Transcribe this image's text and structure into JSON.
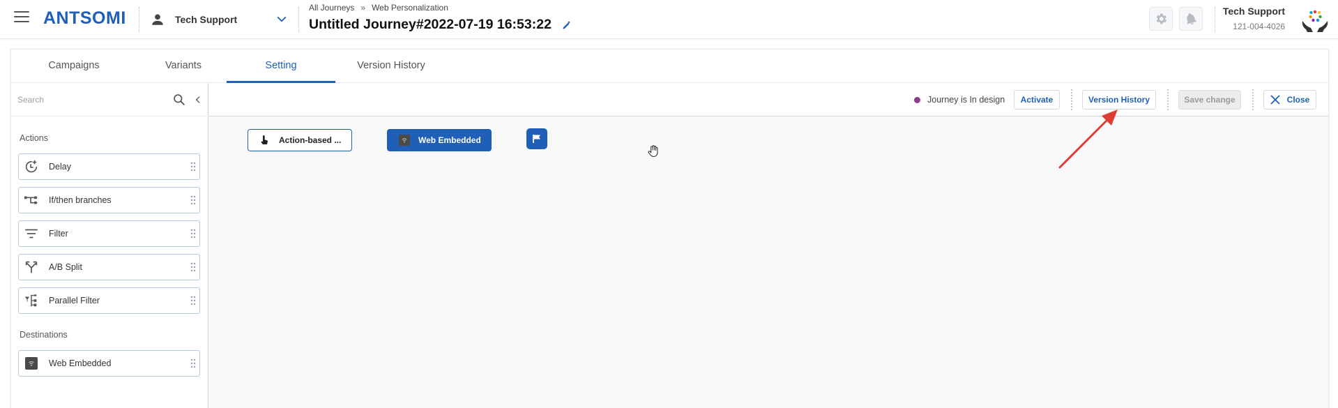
{
  "header": {
    "logo_text": "ANTSOMI",
    "portal_name": "Tech Support",
    "breadcrumb": [
      "All Journeys",
      "»",
      "Web Personalization"
    ],
    "journey_title": "Untitled Journey#2022-07-19 16:53:22",
    "user_name": "Tech Support",
    "user_id": "121-004-4026"
  },
  "tabs": [
    {
      "label": "Campaigns",
      "active": false
    },
    {
      "label": "Variants",
      "active": false
    },
    {
      "label": "Setting",
      "active": true
    },
    {
      "label": "Version History",
      "active": false
    }
  ],
  "sidebar": {
    "search_placeholder": "Search",
    "actions_label": "Actions",
    "actions": [
      {
        "label": "Delay",
        "icon": "delay-clock-icon"
      },
      {
        "label": "If/then branches",
        "icon": "branches-icon"
      },
      {
        "label": "Filter",
        "icon": "filter-icon"
      },
      {
        "label": "A/B Split",
        "icon": "ab-split-icon"
      },
      {
        "label": "Parallel Filter",
        "icon": "parallel-filter-icon"
      }
    ],
    "destinations_label": "Destinations",
    "destinations": [
      {
        "label": "Web Embedded",
        "icon": "web-embedded-icon"
      }
    ]
  },
  "toolbar": {
    "status_text": "Journey is In design",
    "status_color": "#8e3b8c",
    "activate_label": "Activate",
    "version_history_label": "Version History",
    "save_change_label": "Save change",
    "close_label": "Close"
  },
  "flow": {
    "trigger_label": "Action-based ...",
    "destination_label": "Web Embedded",
    "end_icon": "flag-icon"
  },
  "colors": {
    "brand": "#1f5fb8",
    "annotation_arrow": "#e03c31"
  }
}
